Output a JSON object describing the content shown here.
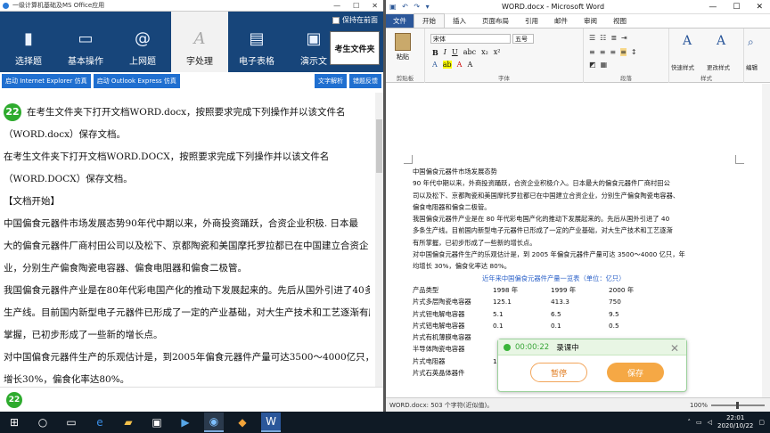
{
  "left_app": {
    "title": "一级计算机基础及MS Office应用",
    "window_controls": [
      "—",
      "☐",
      "✕"
    ],
    "pin_label": "保持在前面",
    "toolbar": [
      {
        "label": "选择题",
        "icon": "document-icon"
      },
      {
        "label": "基本操作",
        "icon": "computer-icon"
      },
      {
        "label": "上网题",
        "icon": "at-icon"
      },
      {
        "label": "字处理",
        "icon": "letter-a-icon",
        "active": true
      },
      {
        "label": "电子表格",
        "icon": "spreadsheet-icon"
      },
      {
        "label": "演示文",
        "icon": "presentation-icon"
      }
    ],
    "exam_folder_button": "考生文件夹",
    "subtoolbar": {
      "ie_button": "启动 Internet Explorer 仿真",
      "outlook_button": "启动 Outlook Express 仿真",
      "analyze_button": "文字解析",
      "hint_button": "错题反馈"
    },
    "question_number": "22",
    "document_lines": [
      "在考生文件夹下打开文档WORD.docx，按照要求完成下列操作并以该文件名",
      "（WORD.docx）保存文档。",
      "在考生文件夹下打开文档WORD.DOCX，按照要求完成下列操作并以该文件名",
      "（WORD.DOCX）保存文档。",
      "【文档开始】",
      "中国偏食元器件市场发展态势90年代中期以来，外商投资踊跃，合资企业积极. 日本最",
      "大的偏食元器件厂商村田公司以及松下、京都陶瓷和美国摩托罗拉都已在中国建立合资企",
      "业，分别生产偏食陶瓷电容器、偏食电阻器和偏食二极管。",
      "我国偏食元器件产业是在80年代彩电国产化的推动下发展起来的。先后从国外引进了40多条",
      "生产线。目前国内新型电子元器件已形成了一定的产业基础，对大生产技术和工艺逐渐有所",
      "掌握，已初步形成了一些新的增长点。",
      "对中国偏食元器件生产的乐观估计是，到2005年偏食元器件产量可达3500～4000亿只，年均",
      "增长30%，偏食化率达80%。"
    ],
    "bottom_badge": "22"
  },
  "word": {
    "quick_access": "▣ ↶ ↷ ▾",
    "title": "WORD.docx - Microsoft Word",
    "window_controls": [
      "—",
      "☐",
      "✕"
    ],
    "tabs": [
      "文件",
      "开始",
      "插入",
      "页面布局",
      "引用",
      "邮件",
      "审阅",
      "视图"
    ],
    "active_tab": "开始",
    "ribbon": {
      "paste_label": "粘贴",
      "clipboard_label": "剪贴板",
      "font_name": "宋体",
      "font_size": "五号",
      "font_group_label": "字体",
      "paragraph_group_label": "段落",
      "quick_styles_label": "快速样式",
      "change_styles_label": "更改样式",
      "styles_group_label": "样式",
      "edit_label": "编辑"
    },
    "document": {
      "lines": [
        "中国偏食元器件市场发展态势",
        "90 年代中期以来，外商投资踊跃，合资企业积极介入。日本最大的偏食元器件厂商村田公",
        "司以及松下、京都陶瓷和美国摩托罗拉都已在中国建立合资企业，分别生产偏食陶瓷电容器、",
        "偏食电阻器和偏食二极管。",
        "我国偏食元器件产业是在 80 年代彩电国产化的推动下发展起来的。先后从国外引进了 40",
        "多条生产线。目前国内新型电子元器件已形成了一定的产业基础，对大生产技术和工艺逐渐",
        "有所掌握，已初步形成了一些新的增长点。",
        "对中国偏食元器件生产的乐观估计是，到 2005 年偏食元器件产量可达 3500～4000 亿只，年",
        "均增长 30%，偏食化率达 80%。"
      ],
      "table_title": "近年来中国偏食元器件产量一览表（单位：亿只）",
      "table_rows": [
        [
          "产品类型",
          "1998 年",
          "1999 年",
          "2000 年"
        ],
        [
          "片式多层陶瓷电容器",
          "125.1",
          "413.3",
          "750"
        ],
        [
          "片式钽电解电容器",
          "5.1",
          "6.5",
          "9.5"
        ],
        [
          "片式铝电解电容器",
          "0.1",
          "0.1",
          "0.5"
        ],
        [
          "片式有机薄膜电容器",
          "",
          "",
          ""
        ],
        [
          "半导体陶瓷电容器",
          "",
          "",
          ""
        ],
        [
          "片式电阻器",
          "1",
          "",
          ""
        ],
        [
          "片式石英晶体器件",
          "",
          "",
          ""
        ]
      ]
    },
    "status": {
      "left": "WORD.docx: 503 个字符(近似值)。",
      "zoom": "100%"
    }
  },
  "recording": {
    "time": "00:00:22",
    "label": "录课中",
    "pause_button": "暂停",
    "save_button": "保存"
  },
  "taskbar": {
    "time": "22:01",
    "date": "2020/10/22"
  }
}
